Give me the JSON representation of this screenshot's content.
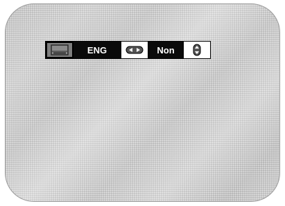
{
  "osd": {
    "icons": {
      "subtitle": "subtitle-icon",
      "left_right": "left-right-arrows-icon",
      "up_down": "up-down-arrows-icon"
    },
    "language_label": "ENG",
    "value_label": "Non"
  },
  "colors": {
    "bar_background": "#0a0a0a",
    "text": "#ffffff",
    "icon_box": "#7e7e7e"
  }
}
